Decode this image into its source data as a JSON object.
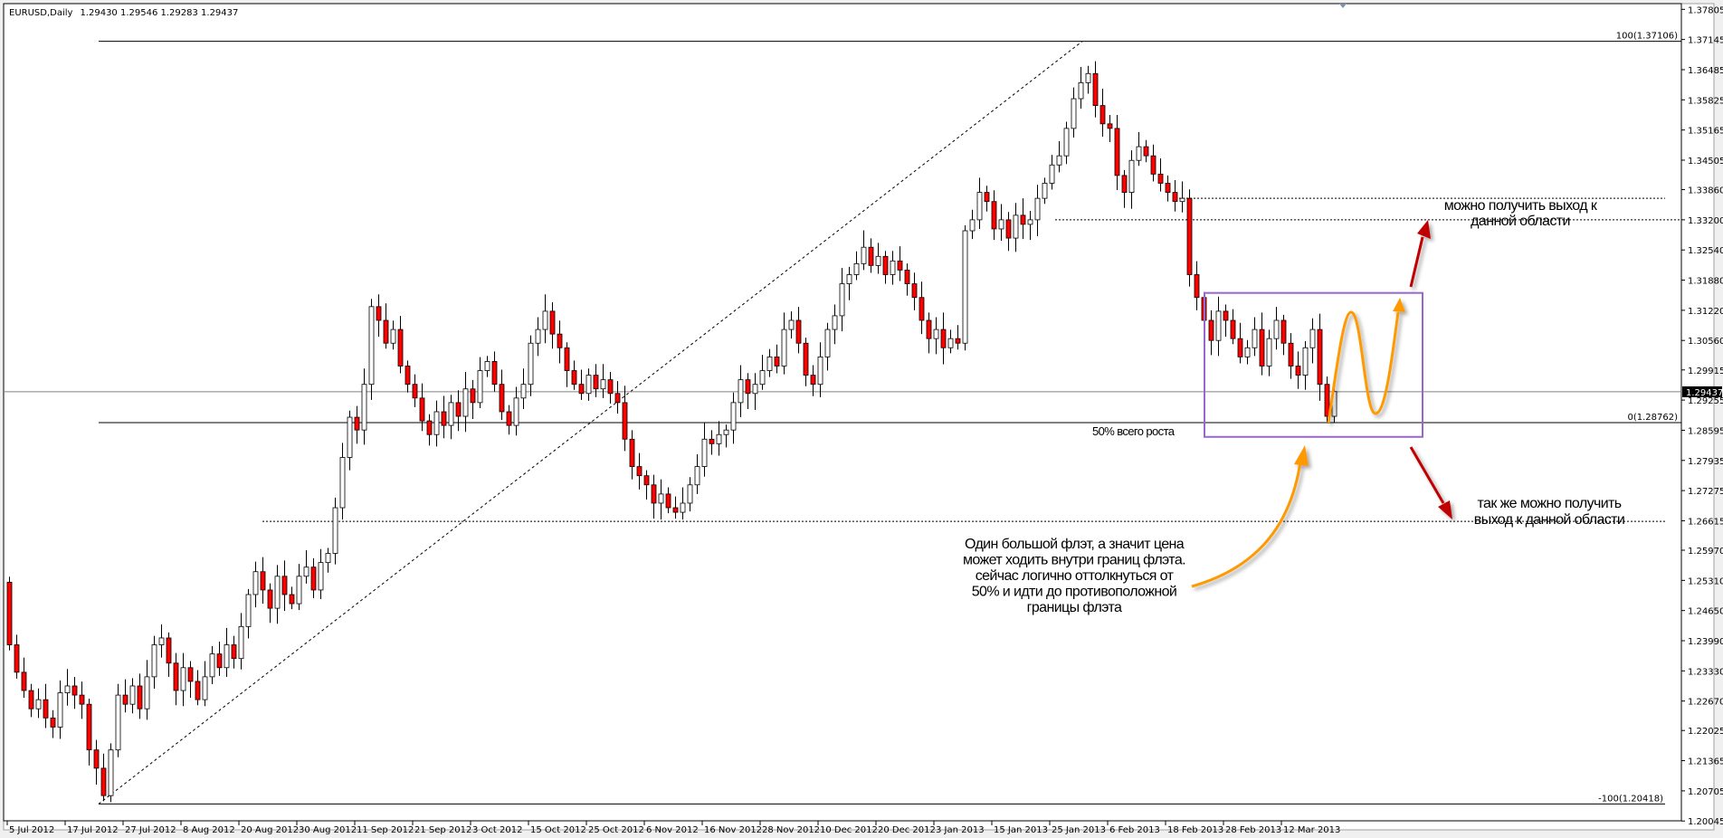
{
  "header": {
    "symbol": "EURUSD,Daily",
    "ohlc": "1.29430 1.29546 1.29283 1.29437"
  },
  "colors": {
    "bull": "#ffffff",
    "bear": "#ff0000",
    "outline": "#000000",
    "box": "#9966cc",
    "orange": "#ff9900",
    "arrow": "#c00000",
    "price_line": "#808080"
  },
  "chart_data": {
    "type": "candlestick",
    "title": "EURUSD,Daily",
    "ylim": [
      1.2,
      1.379
    ],
    "first_open": 1.2527,
    "closes": [
      1.239,
      1.233,
      1.229,
      1.225,
      1.227,
      1.223,
      1.221,
      1.2285,
      1.23,
      1.228,
      1.226,
      1.216,
      1.212,
      1.206,
      1.216,
      1.228,
      1.226,
      1.23,
      1.225,
      1.232,
      1.239,
      1.2405,
      1.235,
      1.229,
      1.234,
      1.231,
      1.227,
      1.232,
      1.237,
      1.234,
      1.239,
      1.236,
      1.243,
      1.25,
      1.255,
      1.251,
      1.247,
      1.254,
      1.25,
      1.248,
      1.254,
      1.256,
      1.251,
      1.257,
      1.259,
      1.269,
      1.28,
      1.2888,
      1.286,
      1.296,
      1.313,
      1.31,
      1.305,
      1.308,
      1.3,
      1.296,
      1.293,
      1.288,
      1.285,
      1.29,
      1.287,
      1.292,
      1.289,
      1.295,
      1.292,
      1.299,
      1.301,
      1.296,
      1.29,
      1.287,
      1.293,
      1.296,
      1.305,
      1.308,
      1.312,
      1.307,
      1.304,
      1.299,
      1.296,
      1.294,
      1.298,
      1.295,
      1.297,
      1.294,
      1.292,
      1.284,
      1.278,
      1.276,
      1.274,
      1.27,
      1.272,
      1.269,
      1.268,
      1.27,
      1.274,
      1.278,
      1.284,
      1.283,
      1.285,
      1.286,
      1.292,
      1.297,
      1.294,
      1.296,
      1.299,
      1.302,
      1.3,
      1.308,
      1.31,
      1.305,
      1.298,
      1.296,
      1.302,
      1.308,
      1.311,
      1.318,
      1.32,
      1.3224,
      1.326,
      1.322,
      1.324,
      1.32,
      1.323,
      1.321,
      1.318,
      1.315,
      1.31,
      1.306,
      1.308,
      1.304,
      1.306,
      1.305,
      1.3296,
      1.332,
      1.338,
      1.336,
      1.33,
      1.332,
      1.328,
      1.333,
      1.331,
      1.332,
      1.3367,
      1.34,
      1.344,
      1.346,
      1.352,
      1.3585,
      1.362,
      1.364,
      1.357,
      1.353,
      1.352,
      1.3417,
      1.338,
      1.345,
      1.348,
      1.346,
      1.342,
      1.34,
      1.338,
      1.336,
      1.3367,
      1.32,
      1.315,
      1.31,
      1.3056,
      1.312,
      1.31,
      1.306,
      1.302,
      1.304,
      1.308,
      1.3,
      1.306,
      1.31,
      1.305,
      1.3,
      1.298,
      1.304,
      1.308,
      1.296,
      1.289,
      1.2944
    ],
    "y_ticks": [
      "1.37805",
      "1.37145",
      "1.36485",
      "1.35825",
      "1.35165",
      "1.34505",
      "1.33860",
      "1.33200",
      "1.32540",
      "1.31880",
      "1.31220",
      "1.30560",
      "1.29915",
      "1.29255",
      "1.28595",
      "1.27935",
      "1.27275",
      "1.26615",
      "1.25970",
      "1.25310",
      "1.24650",
      "1.23990",
      "1.23330",
      "1.22670",
      "1.22025",
      "1.21365",
      "1.20705",
      "1.20045"
    ],
    "x_ticks": [
      {
        "label": "5 Jul 2012",
        "bar": 0
      },
      {
        "label": "17 Jul 2012",
        "bar": 8
      },
      {
        "label": "27 Jul 2012",
        "bar": 16
      },
      {
        "label": "8 Aug 2012",
        "bar": 24
      },
      {
        "label": "20 Aug 2012",
        "bar": 32
      },
      {
        "label": "30 Aug 2012",
        "bar": 40
      },
      {
        "label": "11 Sep 2012",
        "bar": 48
      },
      {
        "label": "21 Sep 2012",
        "bar": 56
      },
      {
        "label": "3 Oct 2012",
        "bar": 64
      },
      {
        "label": "15 Oct 2012",
        "bar": 72
      },
      {
        "label": "25 Oct 2012",
        "bar": 80
      },
      {
        "label": "6 Nov 2012",
        "bar": 88
      },
      {
        "label": "16 Nov 2012",
        "bar": 96
      },
      {
        "label": "28 Nov 2012",
        "bar": 104
      },
      {
        "label": "10 Dec 2012",
        "bar": 112
      },
      {
        "label": "20 Dec 2012",
        "bar": 120
      },
      {
        "label": "3 Jan 2013",
        "bar": 128
      },
      {
        "label": "15 Jan 2013",
        "bar": 136
      },
      {
        "label": "25 Jan 2013",
        "bar": 144
      },
      {
        "label": "6 Feb 2013",
        "bar": 152
      },
      {
        "label": "18 Feb 2013",
        "bar": 160
      },
      {
        "label": "28 Feb 2013",
        "bar": 168
      },
      {
        "label": "12 Mar 2013",
        "bar": 176
      }
    ],
    "current_price": {
      "value": 1.29437,
      "label": "1.29437"
    },
    "fibo": [
      {
        "label": "100(1.37106)",
        "price": 1.37106
      },
      {
        "label": "0(1.28762)",
        "price": 1.28762
      },
      {
        "label": "-100(1.20418)",
        "price": 1.20418
      }
    ],
    "levels": [
      {
        "price": 1.3367,
        "style": "dotted"
      },
      {
        "price": 1.332,
        "style": "dotted"
      },
      {
        "price": 1.266,
        "style": "dotted"
      }
    ],
    "flat_box": {
      "top": 1.316,
      "bottom": 1.2845
    },
    "annotations": {
      "fifty": "50% всего роста",
      "up_target": [
        "можно получить выход к",
        "данной области"
      ],
      "down_target": [
        "так же можно получить",
        "выход к данной области"
      ],
      "note": [
        "Один большой флэт, а значит цена",
        "может ходить внутри границ флэта.",
        "сейчас логично оттолкнуться от",
        "50% и идти до противоположной",
        "границы флэта"
      ]
    }
  }
}
